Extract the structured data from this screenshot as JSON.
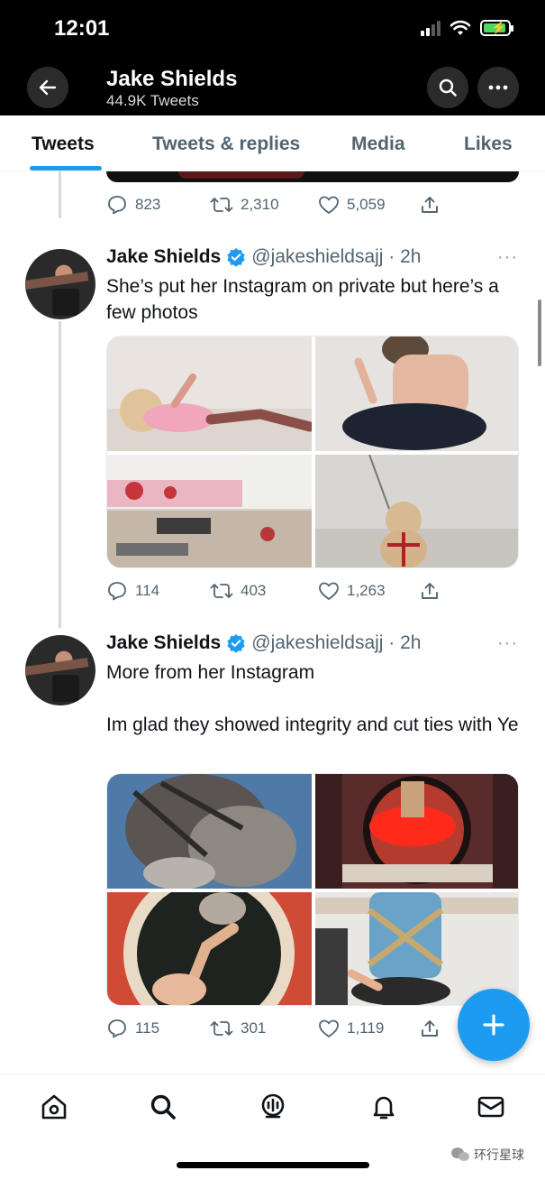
{
  "status_bar": {
    "time": "12:01"
  },
  "header": {
    "name": "Jake Shields",
    "tweet_count": "44.9K Tweets"
  },
  "tabs": [
    {
      "label": "Tweets",
      "active": true
    },
    {
      "label": "Tweets & replies",
      "active": false
    },
    {
      "label": "Media",
      "active": false
    },
    {
      "label": "Likes",
      "active": false
    }
  ],
  "tweets": [
    {
      "replies": "823",
      "retweets": "2,310",
      "likes": "5,059"
    },
    {
      "name": "Jake Shields",
      "handle": "@jakeshieldsajj · 2h",
      "text": "She’s put her Instagram on private but here’s a few photos",
      "replies": "114",
      "retweets": "403",
      "likes": "1,263"
    },
    {
      "name": "Jake Shields",
      "handle": "@jakeshieldsajj · 2h",
      "text": "More from her Instagram\n\nIm glad they showed integrity and cut ties with Ye",
      "replies": "115",
      "retweets": "301",
      "likes": "1,119"
    }
  ],
  "watermark": "环行星球",
  "colors": {
    "accent": "#1d9bf0",
    "header_bg": "#000000",
    "muted": "#536471"
  }
}
